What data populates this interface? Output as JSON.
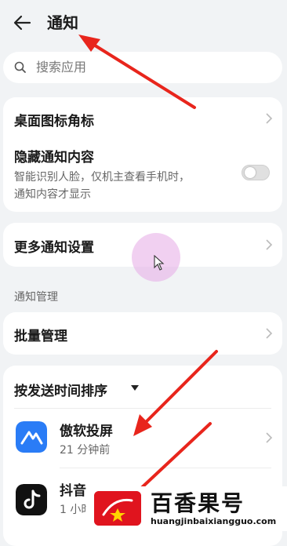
{
  "header": {
    "back_icon": "arrow-left-icon",
    "title": "通知"
  },
  "search": {
    "placeholder": "搜索应用",
    "icon": "search-icon"
  },
  "settings_card_1": {
    "badge_row": {
      "label": "桌面图标角标"
    },
    "hide_row": {
      "label": "隐藏通知内容",
      "desc_line1": "智能识别人脸，仅机主查看手机时，",
      "desc_line2": "通知内容才显示",
      "toggle_on": false
    }
  },
  "more_settings": {
    "label": "更多通知设置"
  },
  "manage_section": {
    "label": "通知管理",
    "batch_label": "批量管理"
  },
  "apps_card": {
    "sort_label": "按发送时间排序",
    "apps": [
      {
        "name": "傲软投屏",
        "time": "21 分钟前",
        "icon_color": "#2a7cf6"
      },
      {
        "name": "抖音",
        "time": "1 小时",
        "icon_color": "#111111"
      }
    ]
  },
  "watermark": {
    "title": "百香果号",
    "url": "huangjinbaixiangguo.com"
  },
  "colors": {
    "arrow": "#e8251c",
    "background": "#f1f3f5",
    "card": "#ffffff"
  }
}
